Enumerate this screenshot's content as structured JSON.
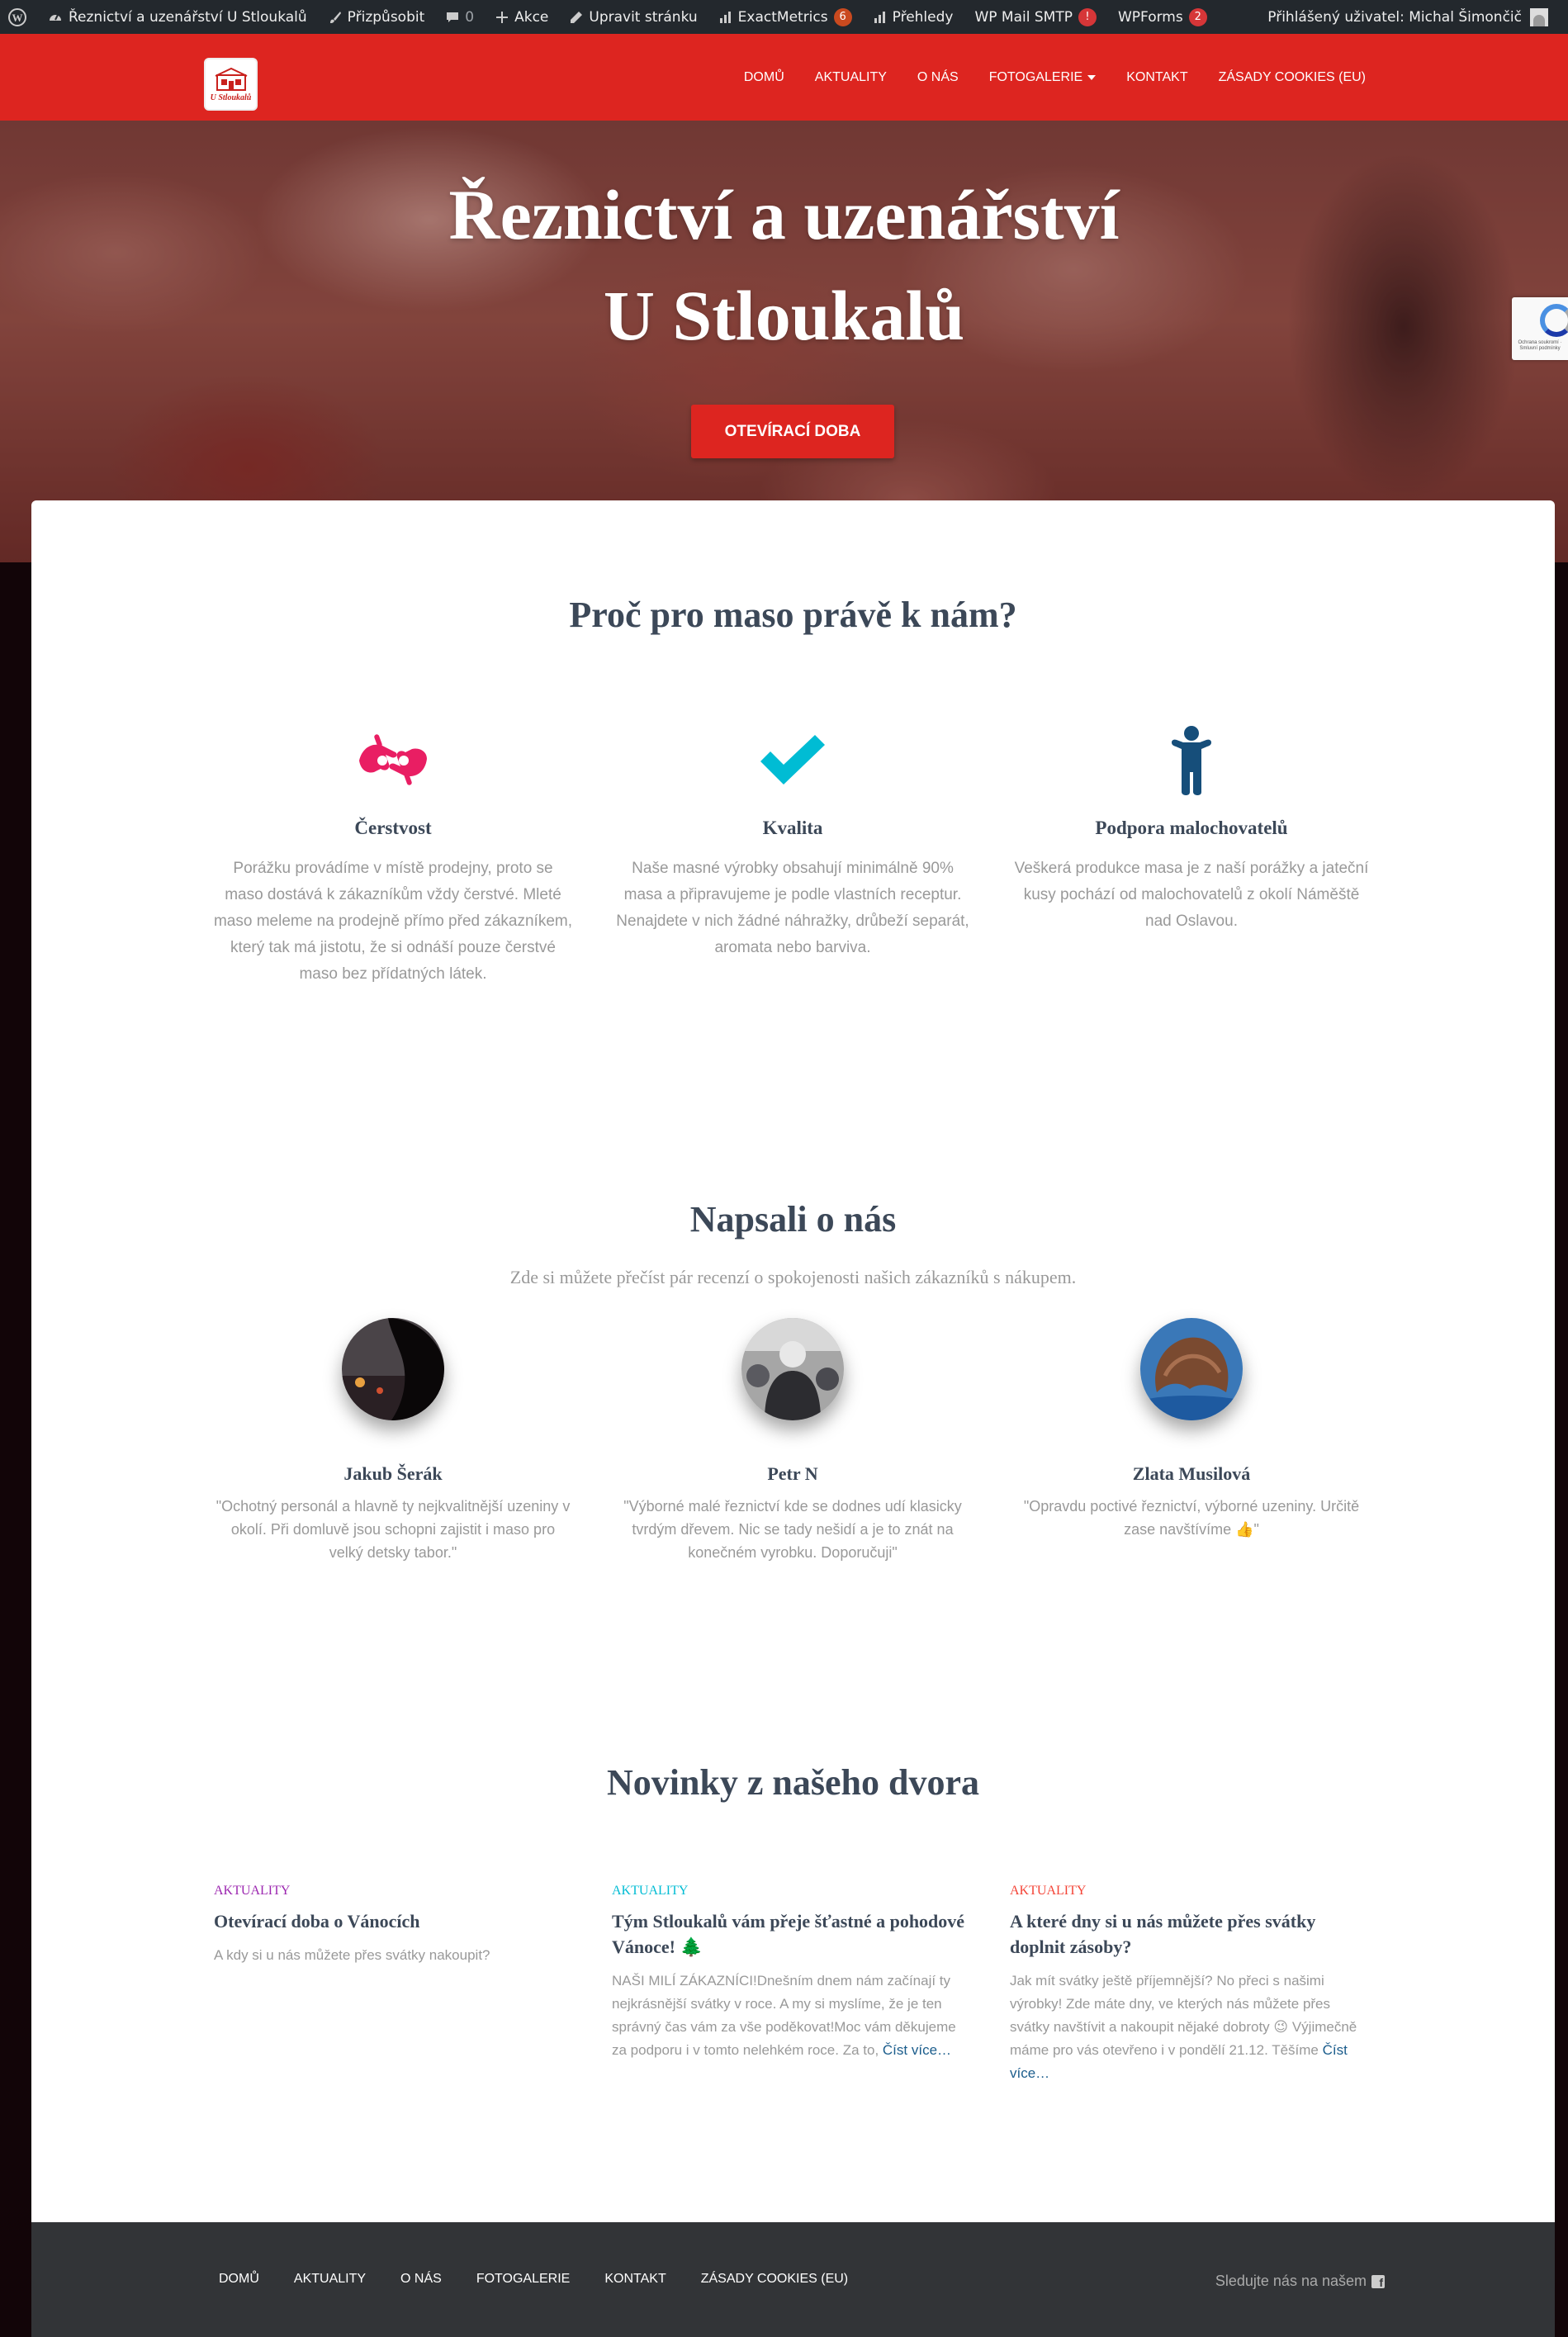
{
  "admin_bar": {
    "site_name": "Řeznictví a uzenářství U Stloukalů",
    "customize": "Přizpůsobit",
    "comments_count": "0",
    "new": "Akce",
    "edit_page": "Upravit stránku",
    "exactmetrics": "ExactMetrics",
    "exactmetrics_badge": "6",
    "overviews": "Přehledy",
    "wp_mail_smtp": "WP Mail SMTP",
    "wp_mail_smtp_badge": "!",
    "wpforms": "WPForms",
    "wpforms_badge": "2",
    "logged_in_user": "Přihlášený uživatel: Michal Šimončič"
  },
  "logo": {
    "text": "U Stloukalů"
  },
  "nav": {
    "items": [
      "Domů",
      "Aktuality",
      "O nás",
      "Fotogalerie",
      "Kontakt",
      "Zásady cookies (EU)"
    ]
  },
  "hero": {
    "title_line1": "Řeznictví a uzenářství",
    "title_line2": "U Stloukalů",
    "button": "OTEVÍRACÍ DOBA"
  },
  "recaptcha": {
    "text": "Ochrana soukromí · Smluvní podmínky"
  },
  "features": {
    "title": "Proč pro maso právě k nám?",
    "items": [
      {
        "icon": "hands-icon",
        "color": "#e91e63",
        "title": "Čerstvost",
        "text": "Porážku provádíme v místě prodejny, proto se maso dostává k zákazníkům vždy čerstvé. Mleté maso meleme na prodejně přímo před zákazníkem, který tak má jistotu, že si odnáší pouze čerstvé maso bez přídatných látek."
      },
      {
        "icon": "checkmark-icon",
        "color": "#00bcd4",
        "title": "Kvalita",
        "text": "Naše masné výrobky obsahují minimálně 90% masa a připravujeme je podle vlastních receptur. Nenajdete v nich žádné náhražky, drůbeží separát, aromata nebo barviva."
      },
      {
        "icon": "person-icon",
        "color": "#164e7a",
        "title": "Podpora malochovatelů",
        "text": "Veškerá produkce masa je z naší porážky a jateční kusy pochází od malochovatelů z okolí Náměště nad Oslavou."
      }
    ]
  },
  "testimonials": {
    "title": "Napsali o nás",
    "subtitle": "Zde si můžete přečíst pár recenzí o spokojenosti našich zákazníků s nákupem.",
    "items": [
      {
        "name": "Jakub Šerák",
        "text": "\"Ochotný personál a hlavně ty nejkvalitnější uzeniny v okolí. Při domluvě jsou schopni zajistit i maso pro velký detsky tabor.\""
      },
      {
        "name": "Petr N",
        "text": "\"Výborné malé řeznictví kde se dodnes udí klasicky tvrdým dřevem. Nic se tady nešidí a je to znát na konečném vyrobku. Doporučuji\""
      },
      {
        "name": "Zlata Musilová",
        "text": "\"Opravdu poctivé řeznictví, výborné uzeniny. Určitě zase navštívíme 👍\""
      }
    ]
  },
  "news": {
    "title": "Novinky z našeho dvora",
    "read_more": "Číst více…",
    "items": [
      {
        "category": "Aktuality",
        "color": "#9c27b0",
        "title": "Otevírací doba o Vánocích",
        "text": "A kdy si u nás můžete přes svátky nakoupit?"
      },
      {
        "category": "Aktuality",
        "color": "#00bcd4",
        "title": "Tým Stloukalů vám přeje šťastné a pohodové Vánoce! 🌲",
        "text": "NAŠI MILÍ ZÁKAZNÍCI!Dnešním dnem nám začínají ty nejkrásnější svátky v roce. A my si myslíme, že je ten správný čas vám za vše poděkovat!Moc vám děkujeme za podporu i v tomto nelehkém roce. Za to,"
      },
      {
        "category": "Aktuality",
        "color": "#f44336",
        "title": "A které dny si u nás můžete přes svátky doplnit zásoby?",
        "text": "Jak mít svátky ještě příjemnější? No přeci s našimi výrobky! Zde máte dny, ve kterých nás můžete přes svátky navštívit a nakoupit nějaké dobroty 😉 Výjimečně máme pro vás otevřeno i v pondělí 21.12. Těšíme"
      }
    ]
  },
  "footer": {
    "links": [
      "Domů",
      "Aktuality",
      "O nás",
      "Fotogalerie",
      "Kontakt",
      "Zásady cookies (EU)"
    ],
    "follow": "Sledujte nás na našem"
  }
}
